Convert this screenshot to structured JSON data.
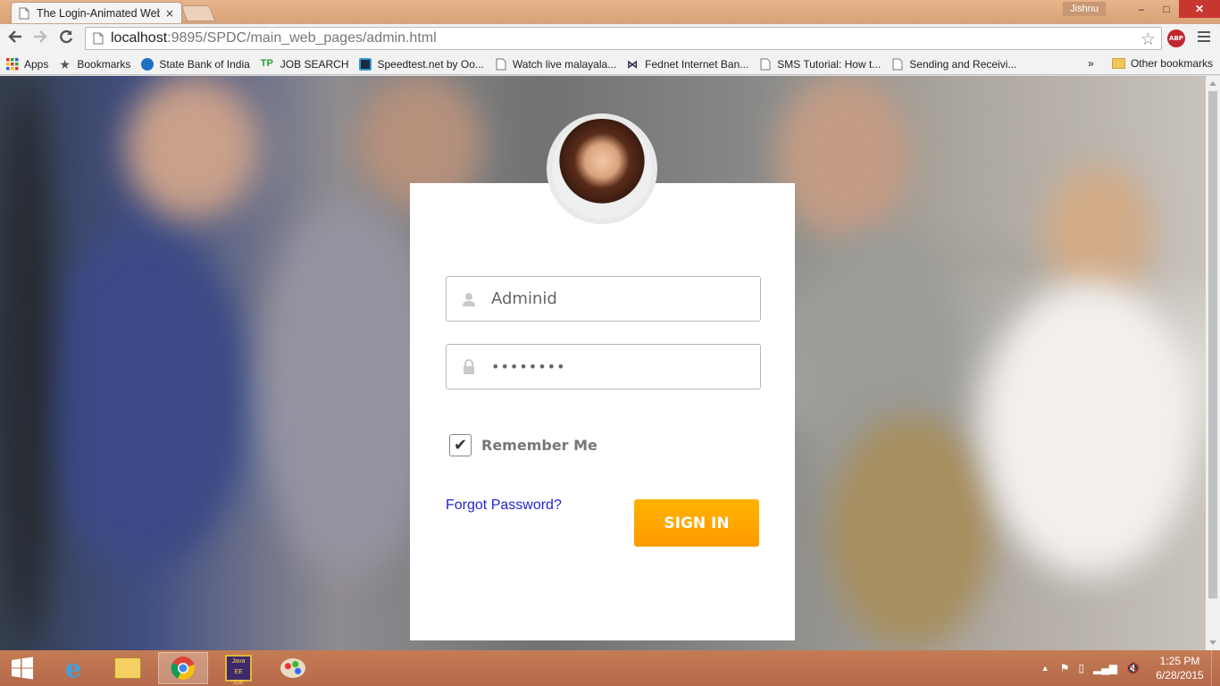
{
  "browser": {
    "tab_title": "The Login-Animated Web",
    "tab_close": "×",
    "user_name": "Jishnu",
    "url_host": "localhost",
    "url_rest": ":9895/SPDC/main_web_pages/admin.html",
    "window_buttons": {
      "minimize": "–",
      "maximize": "□",
      "close": "✕"
    }
  },
  "bookmarks": {
    "items": [
      {
        "label": "Apps",
        "icon": "apps-grid-icon"
      },
      {
        "label": "Bookmarks",
        "icon": "star-icon"
      },
      {
        "label": "State Bank of India",
        "icon": "sbi-icon"
      },
      {
        "label": "JOB SEARCH",
        "icon": "tp-icon"
      },
      {
        "label": "Speedtest.net by Oo...",
        "icon": "speedtest-icon"
      },
      {
        "label": "Watch live malayala...",
        "icon": "page-icon"
      },
      {
        "label": "Fednet Internet Ban...",
        "icon": "fednet-icon"
      },
      {
        "label": "SMS Tutorial: How t...",
        "icon": "page-icon"
      },
      {
        "label": "Sending and Receivi...",
        "icon": "page-icon"
      }
    ],
    "overflow": "»",
    "other": "Other bookmarks"
  },
  "login": {
    "username_value": "Adminid",
    "password_value": "••••••••",
    "remember_label": "Remember Me",
    "remember_checked": "✔",
    "forgot_label": "Forgot Password?",
    "signin_label": "SIGN IN",
    "accent_color": "#ffa500"
  },
  "taskbar": {
    "time": "1:25 PM",
    "date": "6/28/2015"
  }
}
